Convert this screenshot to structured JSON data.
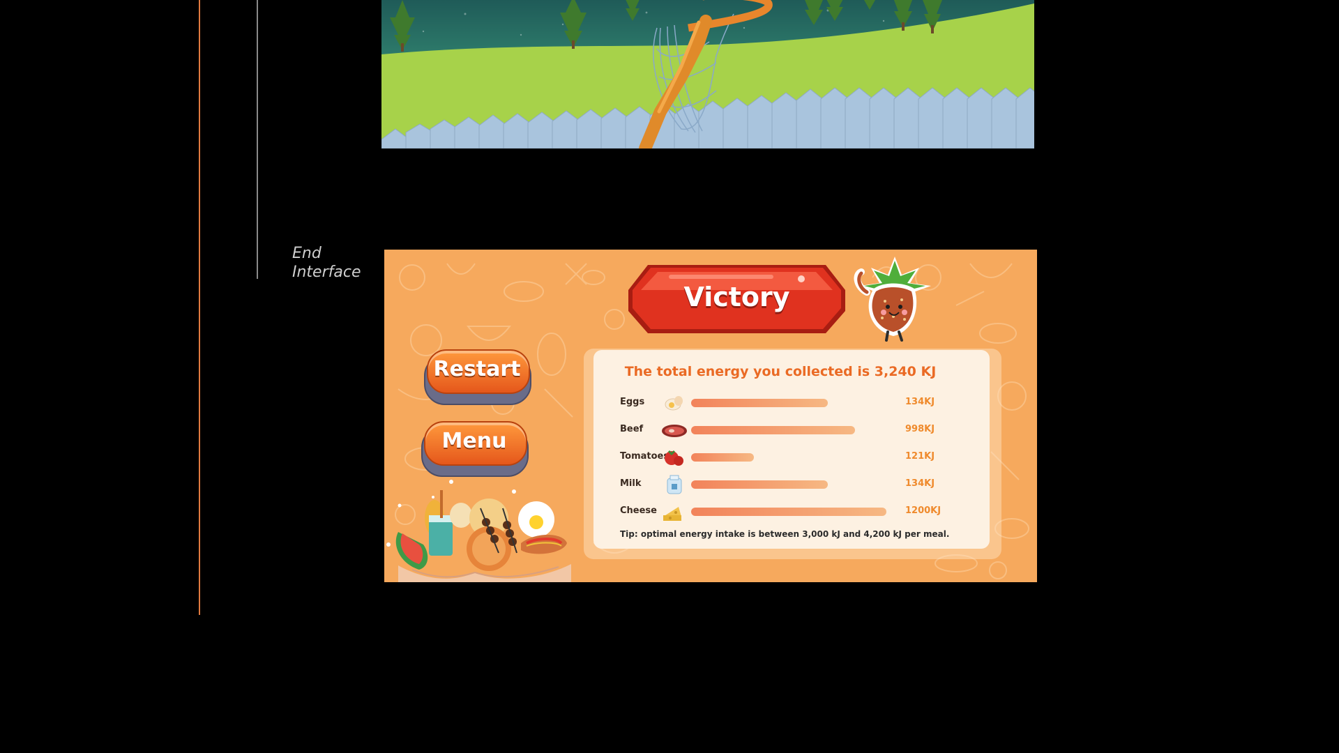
{
  "section": {
    "label_line1": "End",
    "label_line2": "Interface"
  },
  "end_screen": {
    "title": "Victory",
    "buttons": {
      "restart": "Restart",
      "menu": "Menu"
    },
    "total_text": "The total energy you collected is 3,240 KJ",
    "foods": [
      {
        "name": "Eggs",
        "icon": "egg-icon",
        "value_text": "134KJ",
        "level": 0.7
      },
      {
        "name": "Beef",
        "icon": "steak-icon",
        "value_text": "998KJ",
        "level": 0.84
      },
      {
        "name": "Tomatoes",
        "icon": "tomato-icon",
        "value_text": "121KJ",
        "level": 0.32
      },
      {
        "name": "Milk",
        "icon": "milk-icon",
        "value_text": "134KJ",
        "level": 0.7
      },
      {
        "name": "Cheese",
        "icon": "cheese-icon",
        "value_text": "1200KJ",
        "level": 1.0
      }
    ],
    "tip": "Tip: optimal energy intake is between 3,000 kJ and 4,200 kJ per meal.",
    "colors": {
      "panel_bg": "#f6a95d",
      "title_orange": "#ea6a24",
      "value_orange": "#ef8a2c",
      "banner_red": "#e0321f",
      "button_orange": "#f07a2a"
    }
  }
}
